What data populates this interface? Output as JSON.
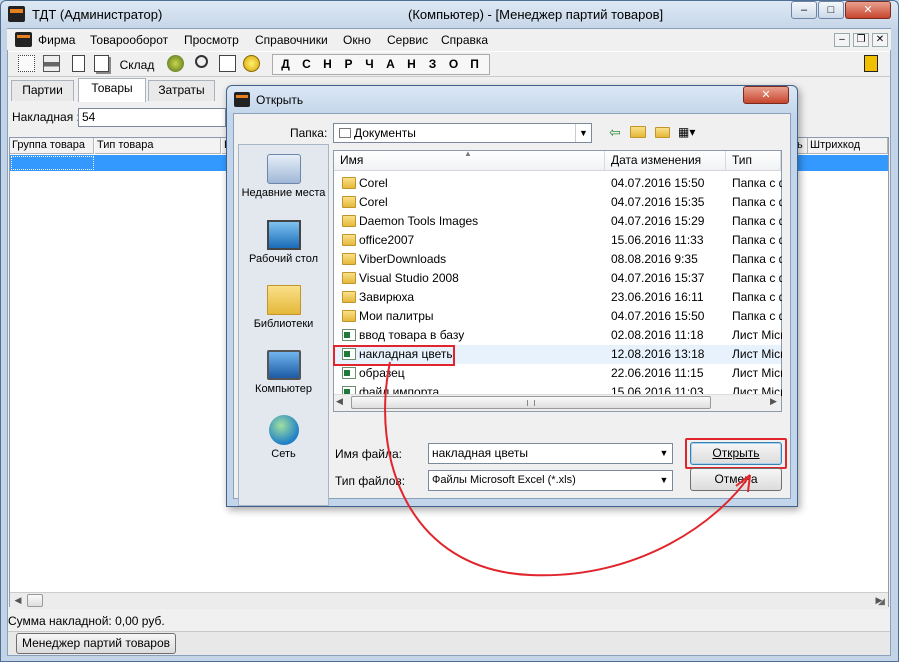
{
  "app": {
    "title": "ТДТ  (Администратор)",
    "title_right": "(Компьютер) - [Менеджер партий товаров]"
  },
  "menu": [
    "Фирма",
    "Товарооборот",
    "Просмотр",
    "Справочники",
    "Окно",
    "Сервис",
    "Справка"
  ],
  "toolbar": {
    "sklad": "Склад",
    "letters": [
      "Д",
      "С",
      "Н",
      "Р",
      "Ч",
      "А",
      "Н",
      "З",
      "О",
      "П"
    ]
  },
  "tabs": [
    "Партии",
    "Товары",
    "Затраты"
  ],
  "nakladnaya": {
    "label": "Накладная :",
    "value": "54"
  },
  "columns": [
    "Группа товара",
    "Тип товара",
    "Г",
    "ть",
    "Штрихкод"
  ],
  "status": {
    "sum": "Сумма накладной:",
    "value": "0,00 руб."
  },
  "taskbar": {
    "item": "Менеджер партий товаров"
  },
  "dialog": {
    "title": "Открыть",
    "folder_label": "Папка:",
    "folder_value": "Документы",
    "places": [
      "Недавние места",
      "Рабочий стол",
      "Библиотеки",
      "Компьютер",
      "Сеть"
    ],
    "headers": {
      "name": "Имя",
      "date": "Дата изменения",
      "type": "Тип"
    },
    "files": [
      {
        "name": "Corel",
        "date": "04.07.2016 15:50",
        "type": "Папка с ф",
        "kind": "folder"
      },
      {
        "name": "Corel",
        "date": "04.07.2016 15:35",
        "type": "Папка с ф",
        "kind": "folder"
      },
      {
        "name": "Daemon Tools Images",
        "date": "04.07.2016 15:29",
        "type": "Папка с ф",
        "kind": "folder"
      },
      {
        "name": "office2007",
        "date": "15.06.2016 11:33",
        "type": "Папка с ф",
        "kind": "folder"
      },
      {
        "name": "ViberDownloads",
        "date": "08.08.2016 9:35",
        "type": "Папка с ф",
        "kind": "folder"
      },
      {
        "name": "Visual Studio 2008",
        "date": "04.07.2016 15:37",
        "type": "Папка с ф",
        "kind": "folder"
      },
      {
        "name": "Завирюха",
        "date": "23.06.2016 16:11",
        "type": "Папка с ф",
        "kind": "folder"
      },
      {
        "name": "Мои палитры",
        "date": "04.07.2016 15:50",
        "type": "Папка с ф",
        "kind": "folder"
      },
      {
        "name": "ввод товара в базу",
        "date": "02.08.2016 11:18",
        "type": "Лист Micr",
        "kind": "xls"
      },
      {
        "name": "накладная цветы",
        "date": "12.08.2016 13:18",
        "type": "Лист Micr",
        "kind": "xls"
      },
      {
        "name": "образец",
        "date": "22.06.2016 11:15",
        "type": "Лист Micr",
        "kind": "xls"
      },
      {
        "name": "файл импорта",
        "date": "15.06.2016 11:03",
        "type": "Лист Micr",
        "kind": "xls"
      }
    ],
    "filename_label": "Имя файла:",
    "filename_value": "накладная цветы",
    "filetype_label": "Тип файлов:",
    "filetype_value": "Файлы Microsoft Excel (*.xls)",
    "open_button": "Открыть",
    "cancel_button": "Отмена"
  }
}
